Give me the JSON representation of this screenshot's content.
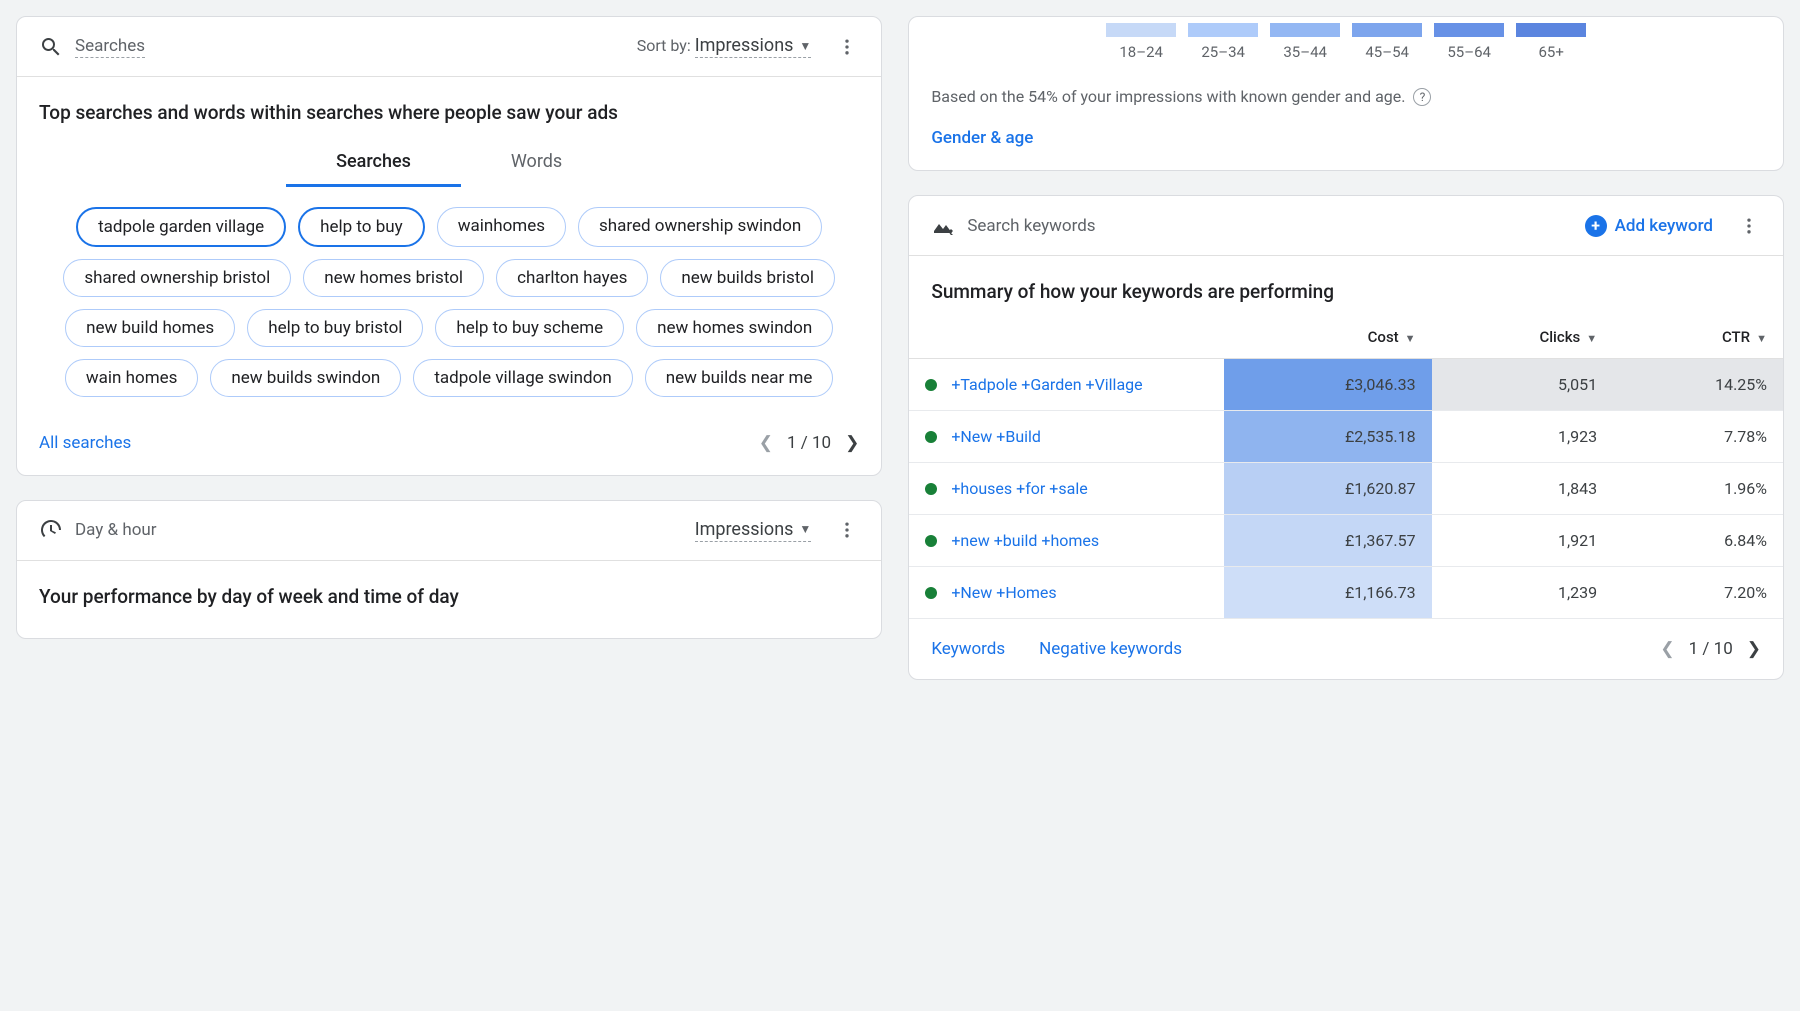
{
  "searches": {
    "header_icon": "search",
    "title": "Searches",
    "sort_label": "Sort by:",
    "sort_value": "Impressions",
    "description": "Top searches and words within searches where people saw your ads",
    "tabs": [
      "Searches",
      "Words"
    ],
    "active_tab": 0,
    "chips": [
      {
        "label": "tadpole garden village",
        "primary": true
      },
      {
        "label": "help to buy",
        "primary": true
      },
      {
        "label": "wainhomes",
        "primary": false
      },
      {
        "label": "shared ownership swindon",
        "primary": false
      },
      {
        "label": "shared ownership bristol",
        "primary": false
      },
      {
        "label": "new homes bristol",
        "primary": false
      },
      {
        "label": "charlton hayes",
        "primary": false
      },
      {
        "label": "new builds bristol",
        "primary": false
      },
      {
        "label": "new build homes",
        "primary": false
      },
      {
        "label": "help to buy bristol",
        "primary": false
      },
      {
        "label": "help to buy scheme",
        "primary": false
      },
      {
        "label": "new homes swindon",
        "primary": false
      },
      {
        "label": "wain homes",
        "primary": false
      },
      {
        "label": "new builds swindon",
        "primary": false
      },
      {
        "label": "tadpole village swindon",
        "primary": false
      },
      {
        "label": "new builds near me",
        "primary": false
      }
    ],
    "footer_link": "All searches",
    "pagination": {
      "current": "1",
      "total": "10"
    }
  },
  "day_hour": {
    "title": "Day & hour",
    "metric": "Impressions",
    "description": "Your performance by day of week and time of day"
  },
  "gender_age": {
    "swatch_colors": [
      "#c6d9f7",
      "#aecbfa",
      "#93b7f3",
      "#7da5ed",
      "#6791e6",
      "#5b85df"
    ],
    "age_labels": [
      "18–24",
      "25–34",
      "35–44",
      "45–54",
      "55–64",
      "65+"
    ],
    "note": "Based on the 54% of your impressions with known gender and age.",
    "link": "Gender & age"
  },
  "keywords": {
    "title": "Search keywords",
    "add_label": "Add keyword",
    "description": "Summary of how your keywords are performing",
    "columns": [
      "Cost",
      "Clicks",
      "CTR"
    ],
    "rows": [
      {
        "status": "green",
        "name": "+Tadpole +Garden +Village",
        "cost": "£3,046.33",
        "clicks": "5,051",
        "ctr": "14.25%",
        "cost_bg": "#6f9eea",
        "clicks_bg": "#e4e6e9",
        "ctr_bg": "#e4e6e9"
      },
      {
        "status": "green",
        "name": "+New +Build",
        "cost": "£2,535.18",
        "clicks": "1,923",
        "ctr": "7.78%",
        "cost_bg": "#8fb4ef",
        "clicks_bg": "#ffffff",
        "ctr_bg": "#ffffff"
      },
      {
        "status": "green",
        "name": "+houses +for +sale",
        "cost": "£1,620.87",
        "clicks": "1,843",
        "ctr": "1.96%",
        "cost_bg": "#b8cff4",
        "clicks_bg": "#ffffff",
        "ctr_bg": "#ffffff"
      },
      {
        "status": "green",
        "name": "+new +build +homes",
        "cost": "£1,367.57",
        "clicks": "1,921",
        "ctr": "6.84%",
        "cost_bg": "#c4d7f6",
        "clicks_bg": "#ffffff",
        "ctr_bg": "#ffffff"
      },
      {
        "status": "green",
        "name": "+New +Homes",
        "cost": "£1,166.73",
        "clicks": "1,239",
        "ctr": "7.20%",
        "cost_bg": "#cedef8",
        "clicks_bg": "#ffffff",
        "ctr_bg": "#ffffff"
      }
    ],
    "footer_links": [
      "Keywords",
      "Negative keywords"
    ],
    "pagination": {
      "current": "1",
      "total": "10"
    }
  }
}
